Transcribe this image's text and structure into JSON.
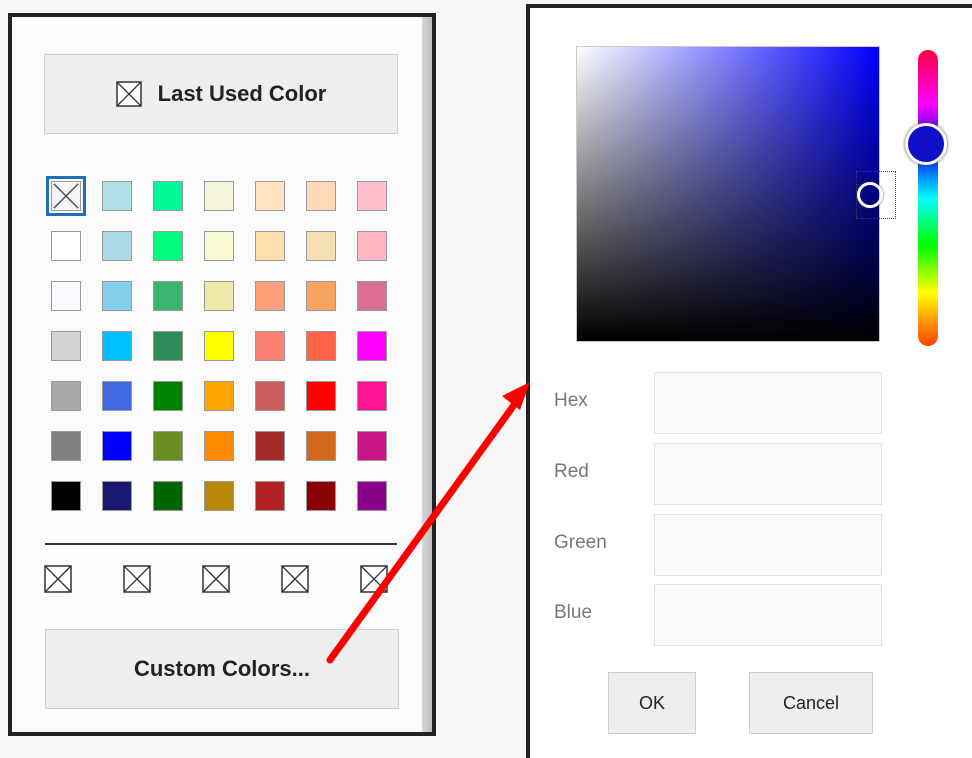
{
  "palette": {
    "last_used_label": "Last Used Color",
    "custom_colors_label": "Custom Colors...",
    "swatches": [
      [
        "none",
        "#b0e0e6",
        "#00fa9a",
        "#f5f5dc",
        "#ffe4c4",
        "#ffdab9",
        "#ffc0cb"
      ],
      [
        "#ffffff",
        "#add8e6",
        "#00ff7f",
        "#fafad2",
        "#ffdead",
        "#f5deb3",
        "#ffb6c1"
      ],
      [
        "#f8f8ff",
        "#87ceeb",
        "#3cb371",
        "#eee8aa",
        "#ffa07a",
        "#f4a460",
        "#db7093"
      ],
      [
        "#d3d3d3",
        "#00bfff",
        "#2e8b57",
        "#ffff00",
        "#fa8072",
        "#ff6347",
        "#ff00ff"
      ],
      [
        "#a9a9a9",
        "#4169e1",
        "#008000",
        "#ffa500",
        "#cd5c5c",
        "#ff0000",
        "#ff1493"
      ],
      [
        "#808080",
        "#0000ff",
        "#6b8e23",
        "#ff8c00",
        "#a52a2a",
        "#d2691e",
        "#c71585"
      ],
      [
        "#000000",
        "#191970",
        "#006400",
        "#b8860b",
        "#b22222",
        "#8b0000",
        "#8b008b"
      ]
    ],
    "selected": "none",
    "custom_slots": 5
  },
  "dialog": {
    "hex_label": "Hex",
    "red_label": "Red",
    "green_label": "Green",
    "blue_label": "Blue",
    "hex_value": "",
    "red_value": "",
    "green_value": "",
    "blue_value": "",
    "ok_label": "OK",
    "cancel_label": "Cancel",
    "hue_color": "#0000ff"
  },
  "annotation": {
    "arrow_color": "#ff0000"
  }
}
